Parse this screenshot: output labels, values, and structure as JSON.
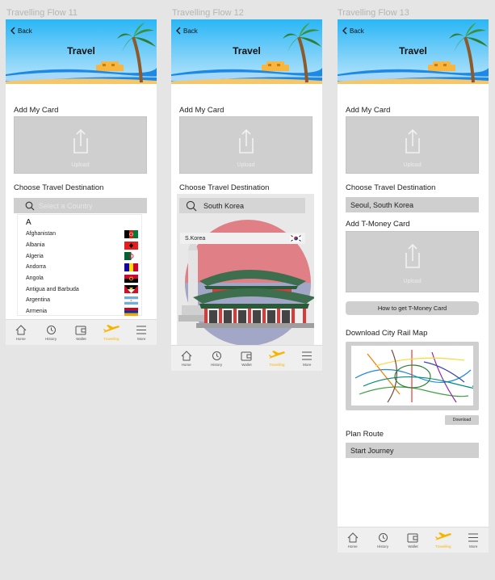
{
  "frames": [
    {
      "title": "Travelling Flow 11"
    },
    {
      "title": "Travelling Flow 12"
    },
    {
      "title": "Travelling Flow 13"
    }
  ],
  "header": {
    "back_label": "Back",
    "title": "Travel"
  },
  "add_card": {
    "label": "Add My Card",
    "upload_label": "Upload"
  },
  "destination": {
    "label": "Choose Travel Destination"
  },
  "flow11": {
    "search_placeholder": "Select a Country",
    "letter": "A",
    "countries": [
      {
        "name": "Afghanistan",
        "flag": "afghanistan"
      },
      {
        "name": "Albania",
        "flag": "albania"
      },
      {
        "name": "Algeria",
        "flag": "algeria"
      },
      {
        "name": "Andorra",
        "flag": "andorra"
      },
      {
        "name": "Angola",
        "flag": "angola"
      },
      {
        "name": "Antigua and Barbuda",
        "flag": "antigua"
      },
      {
        "name": "Argentina",
        "flag": "argentina"
      },
      {
        "name": "Armenia",
        "flag": "armenia"
      }
    ]
  },
  "flow12": {
    "search_value": "South Korea",
    "result_label": "S.Korea"
  },
  "flow13": {
    "destination_value": "Seoul, South Korea",
    "tmoney_label": "Add T-Money Card",
    "tmoney_upload_label": "Upload",
    "how_to_label": "How to get T-Money Card",
    "rail_map_label": "Download City Rail Map",
    "download_label": "Download",
    "plan_route_label": "Plan Route",
    "start_journey_label": "Start Journey"
  },
  "tabbar": {
    "items": [
      {
        "label": "Home",
        "icon": "home-icon"
      },
      {
        "label": "History",
        "icon": "history-icon"
      },
      {
        "label": "Wallet",
        "icon": "wallet-icon"
      },
      {
        "label": "Travelling",
        "icon": "airplane-icon",
        "active": true
      },
      {
        "label": "More",
        "icon": "menu-icon"
      }
    ]
  },
  "colors": {
    "active": "#f7b500",
    "sky_top": "#29b6f6",
    "sea": "#1e88e5",
    "sand": "#f6b640"
  }
}
